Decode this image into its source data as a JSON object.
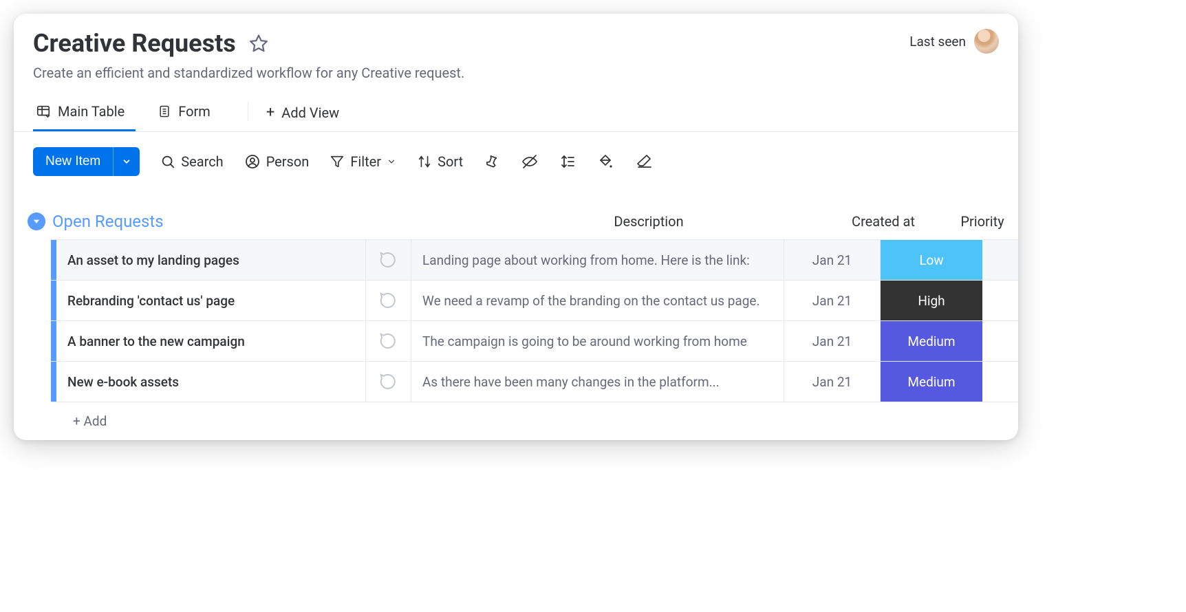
{
  "header": {
    "title": "Creative Requests",
    "subtitle": "Create an efficient and standardized workflow for any Creative request.",
    "last_seen_label": "Last seen"
  },
  "tabs": {
    "main_table": "Main Table",
    "form": "Form",
    "add_view": "Add View"
  },
  "toolbar": {
    "new_item": "New Item",
    "search": "Search",
    "person": "Person",
    "filter": "Filter",
    "sort": "Sort"
  },
  "group": {
    "title": "Open Requests",
    "columns": {
      "description": "Description",
      "created_at": "Created at",
      "priority": "Priority"
    },
    "add_label": "+ Add",
    "rows": [
      {
        "name": "An asset to my landing pages",
        "description": "Landing page about working from home. Here is the link:",
        "created_at": "Jan 21",
        "priority": "Low",
        "priority_color": "#4ec3f7"
      },
      {
        "name": "Rebranding 'contact us' page",
        "description": "We need a revamp of the branding on the contact us page.",
        "created_at": "Jan 21",
        "priority": "High",
        "priority_color": "#333333"
      },
      {
        "name": "A banner to the new campaign",
        "description": "The campaign is going to be around working from home",
        "created_at": "Jan 21",
        "priority": "Medium",
        "priority_color": "#5559df"
      },
      {
        "name": "New e-book assets",
        "description": "As there have been many changes in the platform...",
        "created_at": "Jan 21",
        "priority": "Medium",
        "priority_color": "#5559df"
      }
    ]
  }
}
